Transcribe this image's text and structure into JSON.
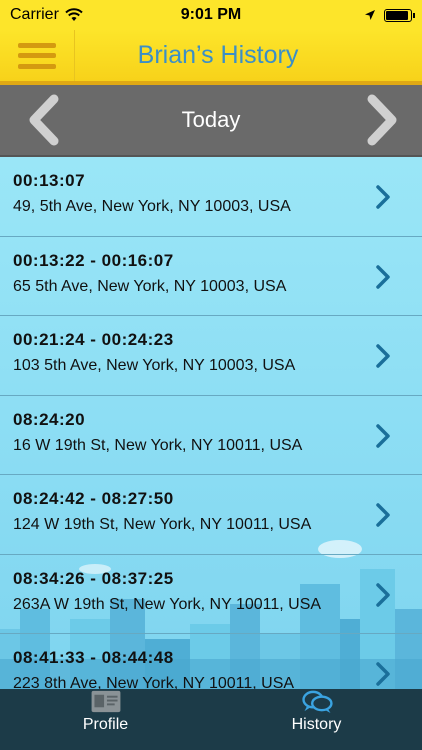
{
  "status": {
    "carrier": "Carrier",
    "time": "9:01 PM"
  },
  "nav": {
    "title": "Brian’s History"
  },
  "day": {
    "label": "Today"
  },
  "entries": [
    {
      "time": "00:13:07",
      "address": "49, 5th Ave, New York, NY 10003, USA"
    },
    {
      "time": "00:13:22 - 00:16:07",
      "address": "65 5th Ave, New York, NY 10003, USA"
    },
    {
      "time": "00:21:24 - 00:24:23",
      "address": "103 5th Ave, New York, NY 10003, USA"
    },
    {
      "time": "08:24:20",
      "address": "16 W 19th St, New York, NY 10011, USA"
    },
    {
      "time": "08:24:42 - 08:27:50",
      "address": "124 W 19th St, New York, NY 10011, USA"
    },
    {
      "time": "08:34:26 - 08:37:25",
      "address": "263A W 19th St, New York, NY 10011, USA"
    },
    {
      "time": "08:41:33 - 08:44:48",
      "address": "223 8th Ave, New York, NY 10011, USA"
    }
  ],
  "tabs": {
    "profile": "Profile",
    "history": "History"
  },
  "colors": {
    "accent_yellow": "#fde52a",
    "title_blue": "#3b8fc7",
    "chevron_blue": "#1a6f9a",
    "tabbar": "#1c3b48"
  },
  "icons": {
    "menu": "hamburger-icon",
    "prev": "chevron-left-icon",
    "next": "chevron-right-icon",
    "profile": "id-card-icon",
    "history": "chat-bubbles-icon"
  }
}
